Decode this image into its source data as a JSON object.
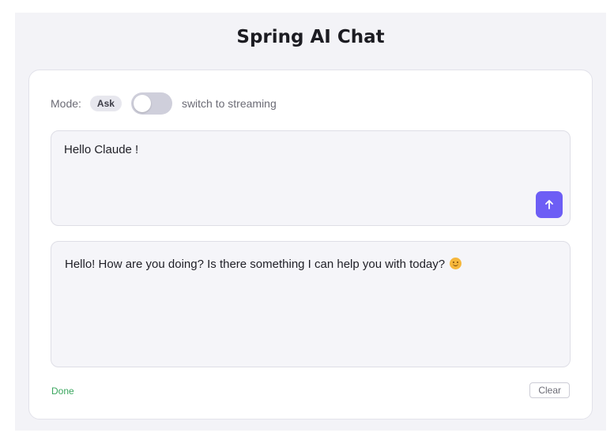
{
  "header": {
    "title": "Spring AI Chat"
  },
  "mode": {
    "label": "Mode:",
    "badge": "Ask",
    "toggle_on": false,
    "toggle_text": "switch to streaming"
  },
  "input": {
    "value": "Hello Claude !"
  },
  "send": {
    "icon": "arrow-up-icon",
    "color": "#6d5ef5"
  },
  "response": {
    "text": "Hello! How are you doing? Is there something I can help you with today?",
    "emoji": "smiling-face-icon"
  },
  "footer": {
    "status": "Done",
    "status_color": "#3aa65e",
    "clear_label": "Clear"
  }
}
